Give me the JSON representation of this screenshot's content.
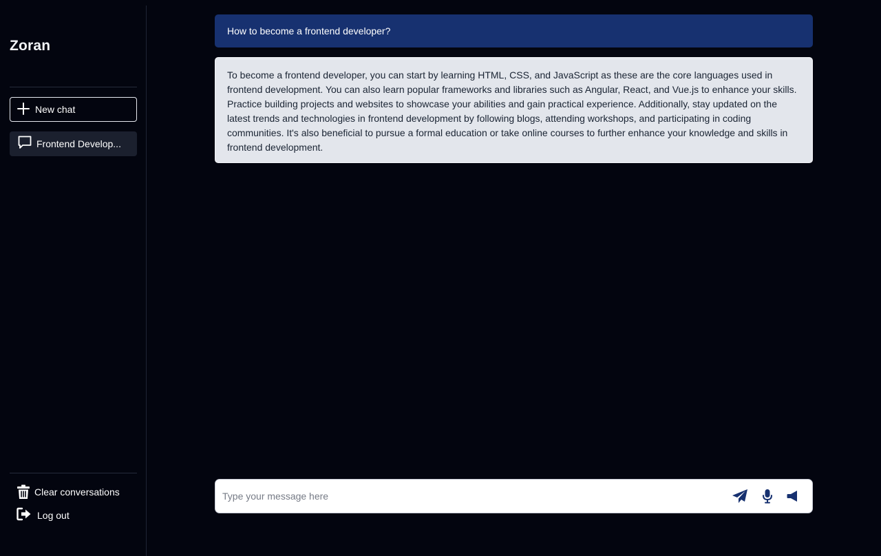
{
  "sidebar": {
    "brand": "Zoran",
    "new_chat_label": "New chat",
    "history": [
      {
        "label": "Frontend Develop..."
      }
    ],
    "clear_label": "Clear conversations",
    "logout_label": "Log out"
  },
  "messages": {
    "user": "How to become a frontend developer?",
    "assistant": "To become a frontend developer, you can start by learning HTML, CSS, and JavaScript as these are the core languages used in frontend development. You can also learn popular frameworks and libraries such as Angular, React, and Vue.js to enhance your skills. Practice building projects and websites to showcase your abilities and gain practical experience. Additionally, stay updated on the latest trends and technologies in frontend development by following blogs, attending workshops, and participating in coding communities. It's also beneficial to pursue a formal education or take online courses to further enhance your knowledge and skills in frontend development."
  },
  "composer": {
    "placeholder": "Type your message here",
    "value": ""
  },
  "icons": {
    "new_chat": "plus-icon",
    "history": "chat-bubble-icon",
    "clear": "trash-icon",
    "logout": "logout-icon",
    "send": "send-icon",
    "mic": "microphone-icon",
    "speaker": "speaker-icon"
  },
  "colors": {
    "background": "#03050f",
    "user_bubble": "#173170",
    "assistant_bubble": "#e3e6ec",
    "accent_icon": "#173170"
  }
}
